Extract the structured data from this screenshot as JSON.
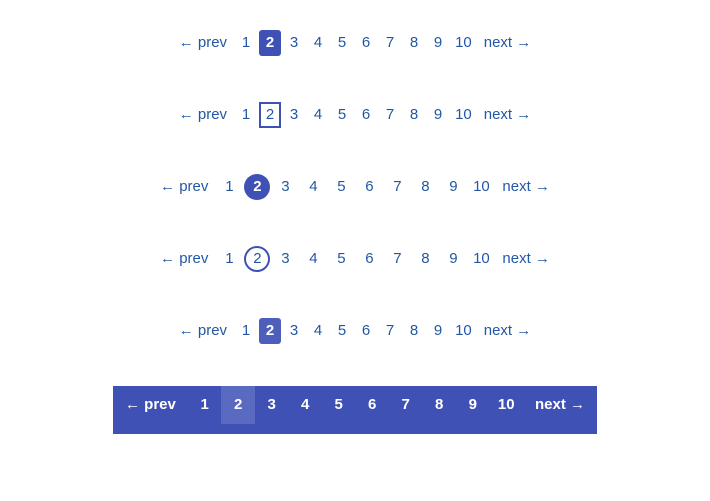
{
  "prev_label": "← prev",
  "next_label": "next →",
  "pages": [
    "1",
    "2",
    "3",
    "4",
    "5",
    "6",
    "7",
    "8",
    "9",
    "10"
  ],
  "active_page_index": 1,
  "variants": [
    {
      "id": "v1",
      "style": "square-filled"
    },
    {
      "id": "v2",
      "style": "square-outline"
    },
    {
      "id": "v3",
      "style": "circle-filled"
    },
    {
      "id": "v4",
      "style": "circle-outline"
    },
    {
      "id": "v5",
      "style": "rounded-filled"
    },
    {
      "id": "v6",
      "style": "bar-full"
    }
  ]
}
